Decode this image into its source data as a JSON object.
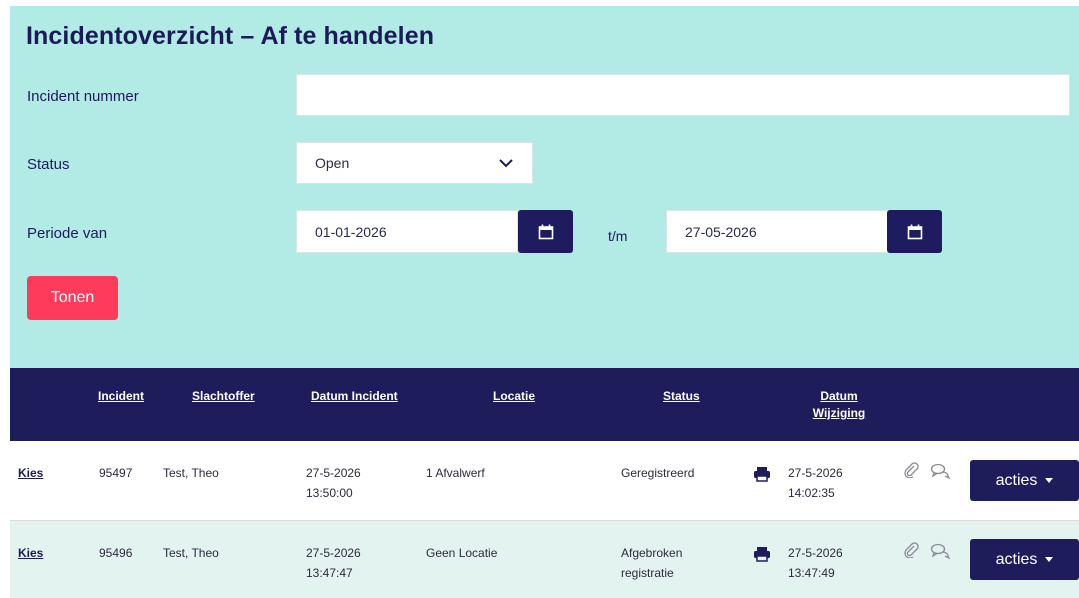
{
  "page": {
    "title": "Incidentoverzicht – Af te handelen"
  },
  "filters": {
    "incident_nummer_label": "Incident nummer",
    "incident_nummer_value": "",
    "status_label": "Status",
    "status_value": "Open",
    "periode_label": "Periode van",
    "periode_van_value": "01-01-2026",
    "tm_label": "t/m",
    "periode_tm_value": "27-05-2026",
    "tonen_label": "Tonen"
  },
  "table": {
    "headers": {
      "incident": "Incident",
      "slachtoffer": "Slachtoffer",
      "datum_incident": "Datum Incident",
      "locatie": "Locatie",
      "status": "Status",
      "datum_wijziging_1": "Datum",
      "datum_wijziging_2": "Wijziging"
    },
    "rows": [
      {
        "kies": "Kies",
        "incident": "95497",
        "slachtoffer": "Test, Theo",
        "datum_incident_date": "27-5-2026",
        "datum_incident_time": "13:50:00",
        "locatie": "1 Afvalwerf",
        "status_line1": "Geregistreerd",
        "status_line2": "",
        "wijziging_date": "27-5-2026",
        "wijziging_time": "14:02:35",
        "acties": "acties"
      },
      {
        "kies": "Kies",
        "incident": "95496",
        "slachtoffer": "Test, Theo",
        "datum_incident_date": "27-5-2026",
        "datum_incident_time": "13:47:47",
        "locatie": "Geen Locatie",
        "status_line1": "Afgebroken",
        "status_line2": "registratie",
        "wijziging_date": "27-5-2026",
        "wijziging_time": "13:47:49",
        "acties": "acties"
      }
    ]
  },
  "icons": {
    "calendar": "calendar-icon",
    "chevron": "chevron-down-icon",
    "print": "printer-icon",
    "attachment": "paperclip-icon",
    "comments": "chat-bubbles-icon",
    "caret": "caret-down-icon"
  },
  "colors": {
    "panel_bg": "#b2ebe5",
    "navy": "#1f1c5c",
    "button_red": "#ff3b5c",
    "row_alt": "#e3f3f0"
  }
}
